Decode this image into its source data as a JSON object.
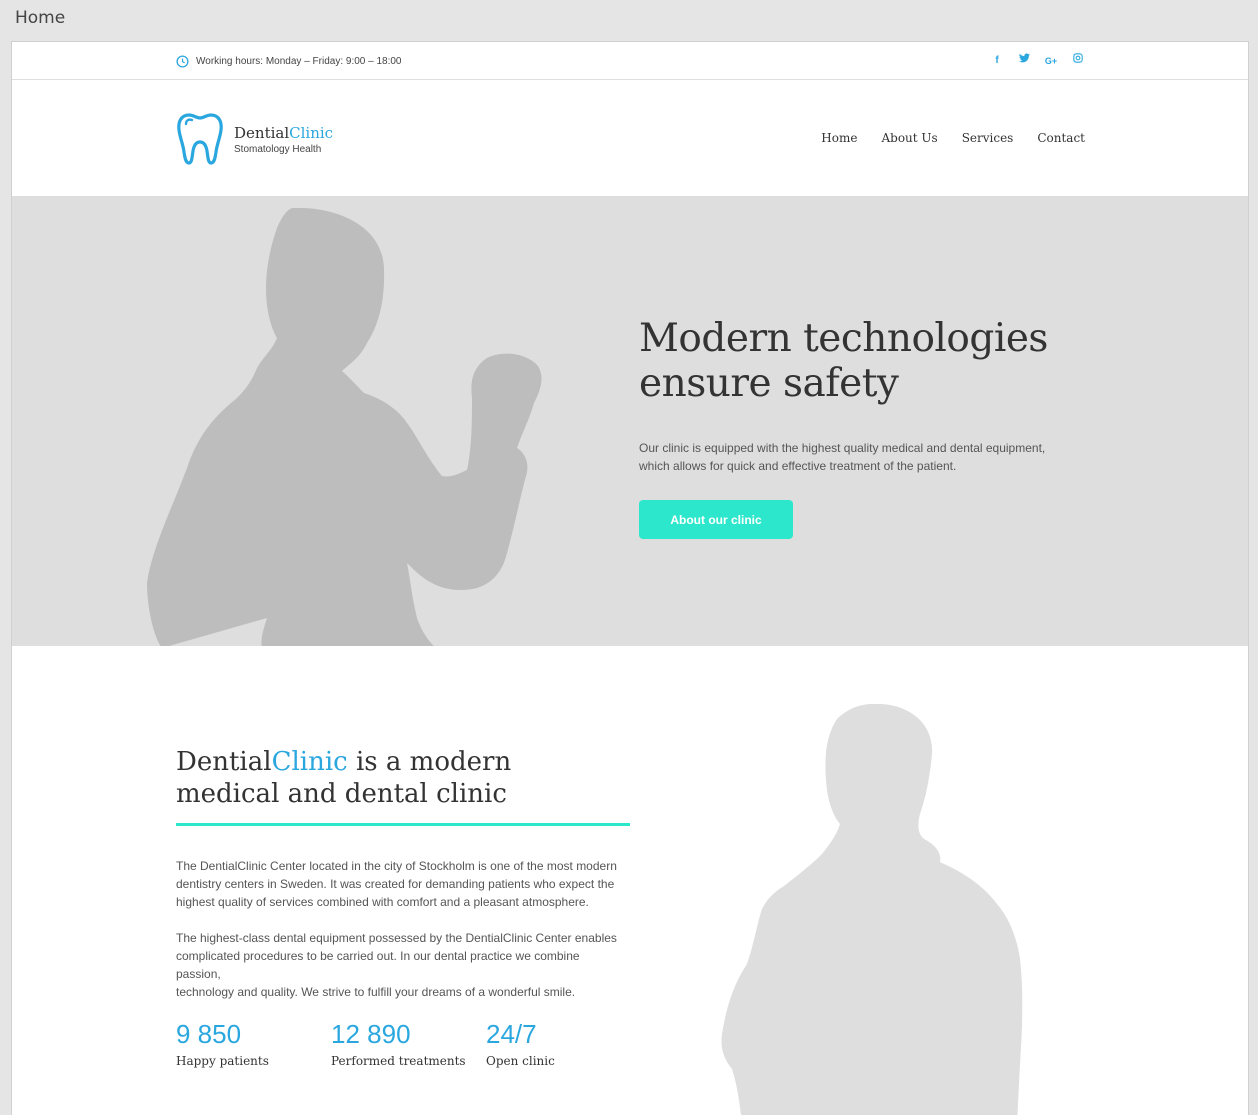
{
  "window": {
    "title": "Home"
  },
  "topbar": {
    "working_hours": "Working hours: Monday – Friday: 9:00 – 18:00",
    "social": [
      {
        "icon": "facebook-icon",
        "glyph": "f"
      },
      {
        "icon": "twitter-icon",
        "glyph": "t"
      },
      {
        "icon": "google-plus-icon",
        "glyph": "G+"
      },
      {
        "icon": "instagram-icon",
        "glyph": "◎"
      }
    ]
  },
  "header": {
    "brand_main": "Dential",
    "brand_accent": "Clinic",
    "tagline": "Stomatology Health",
    "nav": [
      "Home",
      "About Us",
      "Services",
      "Contact"
    ]
  },
  "hero": {
    "title_line1": "Modern technologies",
    "title_line2": "ensure safety",
    "description_line1": "Our clinic is equipped with the highest quality medical and dental equipment,",
    "description_line2": "which allows for quick and effective treatment of the patient.",
    "button_label": "About our clinic"
  },
  "about": {
    "title_brand_main": "Dential",
    "title_brand_accent": "Clinic",
    "title_rest1": " is a modern",
    "title_rest2": "medical and dental clinic",
    "paragraph1_lines": [
      "The DentialClinic Center located in the city of Stockholm is one of the most modern",
      "dentistry centers in Sweden. It was created for demanding patients who expect the",
      "highest quality of services combined with comfort and a pleasant atmosphere."
    ],
    "paragraph2_lines": [
      "The highest-class dental equipment possessed by the DentialClinic Center enables",
      "complicated procedures to be carried out. In our dental practice we combine passion,",
      "technology and quality. We strive to fulfill your dreams of a wonderful smile."
    ],
    "stats": [
      {
        "value": "9 850",
        "label": "Happy patients"
      },
      {
        "value": "12 890",
        "label": "Performed treatments"
      },
      {
        "value": "24/7",
        "label": "Open clinic"
      }
    ]
  },
  "colors": {
    "accent_blue": "#2aa7df",
    "accent_teal": "#2de7cc",
    "hero_bg": "#dedede",
    "silhouette": "#bdbdbd"
  }
}
